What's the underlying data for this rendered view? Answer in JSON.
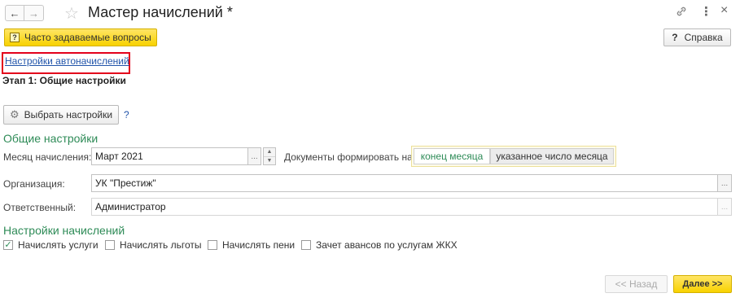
{
  "window": {
    "title": "Мастер начислений *",
    "link_icon": "link-icon",
    "menu_icon": "more-vertical-icon",
    "close_icon": "close-icon"
  },
  "toolbar": {
    "faq_icon": "?",
    "faq_label": "Часто задаваемые вопросы",
    "help_icon": "?",
    "help_label": "Справка"
  },
  "link": {
    "auto_settings": "Настройки автоначислений"
  },
  "stage_title": "Этап 1: Общие настройки",
  "choose_settings": {
    "label": "Выбрать настройки",
    "help": "?"
  },
  "general": {
    "heading": "Общие настройки",
    "month_label": "Месяц начисления:",
    "month_value": "Март 2021",
    "dots": "...",
    "docs_label": "Документы формировать на:",
    "docs_options": [
      "конец месяца",
      "указанное число месяца"
    ],
    "docs_selected": "конец месяца",
    "org_label": "Организация:",
    "org_value": "УК \"Престиж\"",
    "resp_label": "Ответственный:",
    "resp_value": "Администратор"
  },
  "accrual": {
    "heading": "Настройки начислений",
    "checkboxes": [
      {
        "label": "Начислять услуги",
        "checked": true
      },
      {
        "label": "Начислять льготы",
        "checked": false
      },
      {
        "label": "Начислять пени",
        "checked": false
      },
      {
        "label": "Зачет авансов по услугам ЖКХ",
        "checked": false
      }
    ]
  },
  "footer": {
    "back_label": "<< Назад",
    "next_label": "Далее >>"
  },
  "colors": {
    "accent_green": "#2e8b57",
    "yellow": "#f8d200",
    "link_blue": "#2255aa",
    "highlight_red": "#e3001b"
  }
}
